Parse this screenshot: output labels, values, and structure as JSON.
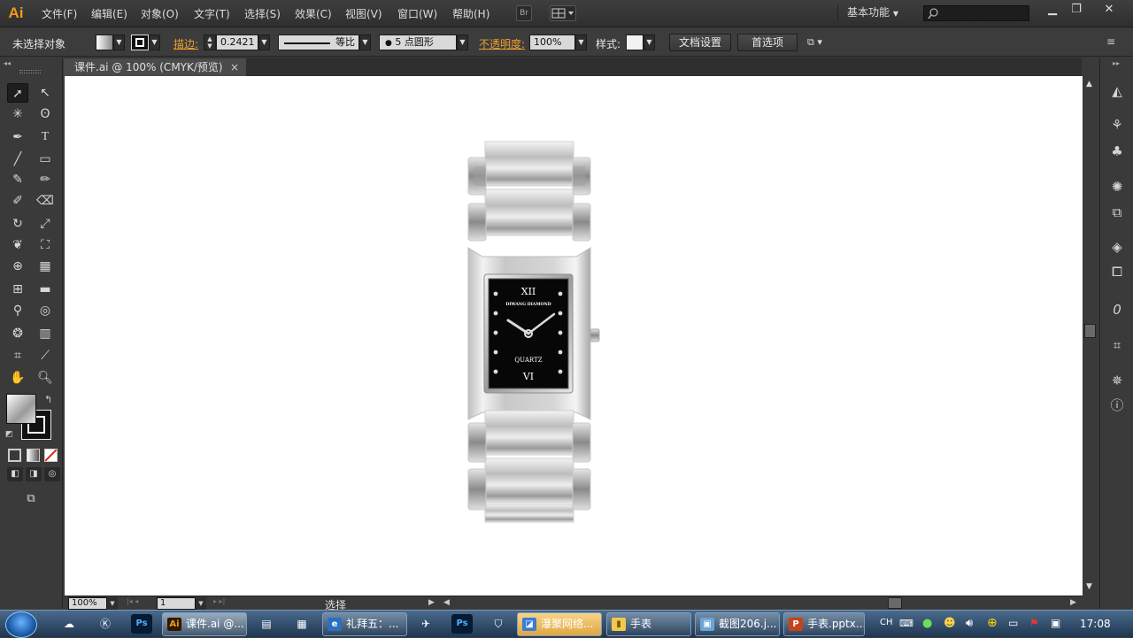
{
  "app": {
    "logo": "Ai"
  },
  "menu": [
    "文件(F)",
    "编辑(E)",
    "对象(O)",
    "文字(T)",
    "选择(S)",
    "效果(C)",
    "视图(V)",
    "窗口(W)",
    "帮助(H)"
  ],
  "menubar": {
    "bridge_label": "Br",
    "workspace": "基本功能",
    "search_placeholder": ""
  },
  "controlbar": {
    "selection": "未选择对象",
    "stroke_label": "描边:",
    "stroke_value": "0.2421",
    "stroke_style": "等比",
    "brush": "5 点圆形",
    "opacity_label": "不透明度:",
    "opacity_value": "100%",
    "style_label": "样式:",
    "doc_setup": "文档设置",
    "preferences": "首选项"
  },
  "document": {
    "tab_title": "课件.ai @ 100% (CMYK/预览)",
    "close": "×"
  },
  "watch": {
    "brand": "DIWANG DIAMOND",
    "movement": "QUARTZ",
    "numeral_top": "XII",
    "numeral_bottom": "VI"
  },
  "statusbar": {
    "zoom": "100%",
    "page": "1",
    "tool": "选择"
  },
  "taskbar": {
    "tasks": [
      "课件.ai @...",
      "礼拜五：...",
      "瀑聚网络...",
      "手表",
      "截图206.j...",
      "手表.pptx..."
    ],
    "tray_lang": "CH",
    "clock": "17:08"
  },
  "colors": {
    "ai_orange": "#f39a17",
    "highlight": "#f0a030",
    "canvas": "#ffffff",
    "ui_dark": "#3a3a3a"
  }
}
